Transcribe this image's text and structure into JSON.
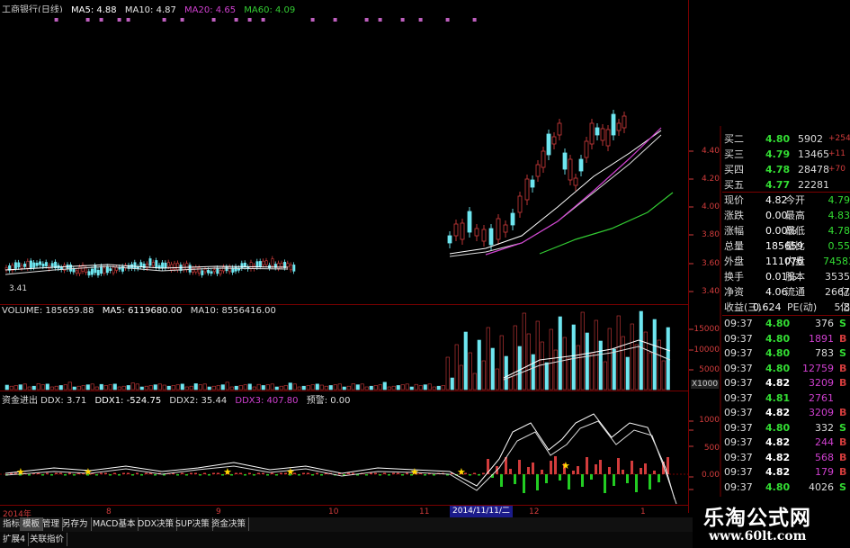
{
  "main_header": {
    "title": "工商银行(日线)",
    "ma5": "MA5: 4.88",
    "ma10": "MA10: 4.87",
    "ma20": "MA20: 4.65",
    "ma60": "MA60: 4.09",
    "colors": {
      "title": "#cfcfcf",
      "ma5": "#ffffff",
      "ma10": "#e8e8e8",
      "ma20": "#d040d0",
      "ma60": "#33cc33"
    }
  },
  "price_axis": [
    "4.40",
    "4.20",
    "4.00",
    "3.80",
    "3.60",
    "3.40"
  ],
  "low_label": "3.41",
  "volume_header": {
    "title": "VOLUME: 185659.88",
    "ma5": "MA5: 6119680.00",
    "ma10": "MA10: 8556416.00"
  },
  "volume_axis": [
    "15000",
    "10000",
    "5000"
  ],
  "volume_unit": "X1000",
  "ddx_header": {
    "title": "资金进出 DDX: 3.71",
    "ddx1": "DDX1: -524.75",
    "ddx2": "DDX2: 35.44",
    "ddx3": "DDX3: 407.80",
    "warn": "预警: 0.00"
  },
  "ddx_axis": [
    "1000",
    "500",
    "0.00"
  ],
  "x_labels": [
    "2014年",
    "8",
    "9",
    "10",
    "11",
    "12",
    "1"
  ],
  "date_cursor": "2014/11/11/二",
  "quotes": [
    {
      "label": "买二",
      "price": "4.80",
      "vol": "5902",
      "chg": "+254"
    },
    {
      "label": "买三",
      "price": "4.79",
      "vol": "13465",
      "chg": "+11"
    },
    {
      "label": "买四",
      "price": "4.78",
      "vol": "28478",
      "chg": "+70"
    },
    {
      "label": "买五",
      "price": "4.77",
      "vol": "22281",
      "chg": ""
    }
  ],
  "stats": [
    {
      "k1": "现价",
      "v1": "4.82",
      "k2": "今开",
      "v2": "4.79"
    },
    {
      "k1": "涨跌",
      "v1": "0.00",
      "k2": "最高",
      "v2": "4.83"
    },
    {
      "k1": "涨幅",
      "v1": "0.00%",
      "k2": "最低",
      "v2": "4.78"
    },
    {
      "k1": "总量",
      "v1": "185659",
      "k2": "量比",
      "v2": "0.55"
    },
    {
      "k1": "外盘",
      "v1": "111076",
      "k2": "内盘",
      "v2": "74583"
    },
    {
      "k1": "换手",
      "v1": "0.01%",
      "k2": "股本",
      "v2": "3535亿"
    },
    {
      "k1": "净资",
      "v1": "4.06",
      "k2": "流通",
      "v2": "2667亿"
    },
    {
      "k1": "收益(三)",
      "v1": "0.624",
      "k2": "PE(动)",
      "v2": "5.8"
    }
  ],
  "ticks": [
    {
      "t": "09:37",
      "p": "4.80",
      "v": "376",
      "s": "S"
    },
    {
      "t": "09:37",
      "p": "4.80",
      "v": "1891",
      "s": "B"
    },
    {
      "t": "09:37",
      "p": "4.80",
      "v": "783",
      "s": "S"
    },
    {
      "t": "09:37",
      "p": "4.80",
      "v": "12759",
      "s": "B"
    },
    {
      "t": "09:37",
      "p": "4.82",
      "v": "3209",
      "s": "B"
    },
    {
      "t": "09:37",
      "p": "4.81",
      "v": "2761",
      "s": ""
    },
    {
      "t": "09:37",
      "p": "4.82",
      "v": "3209",
      "s": "B"
    },
    {
      "t": "09:37",
      "p": "4.80",
      "v": "332",
      "s": "S"
    },
    {
      "t": "09:37",
      "p": "4.82",
      "v": "244",
      "s": "B"
    },
    {
      "t": "09:37",
      "p": "4.82",
      "v": "568",
      "s": "B"
    },
    {
      "t": "09:37",
      "p": "4.82",
      "v": "179",
      "s": "B"
    },
    {
      "t": "09:37",
      "p": "4.80",
      "v": "4026",
      "s": "S"
    }
  ],
  "tabs_row1": [
    "指标",
    "模板",
    "管理",
    "另存为",
    "MACD基本",
    "DDX决策",
    "SUP决策",
    "资金决策"
  ],
  "tabs_row2": [
    "扩展4",
    "关联指价"
  ],
  "watermark": {
    "title": "乐淘公式网",
    "url": "www.60lt.com"
  }
}
